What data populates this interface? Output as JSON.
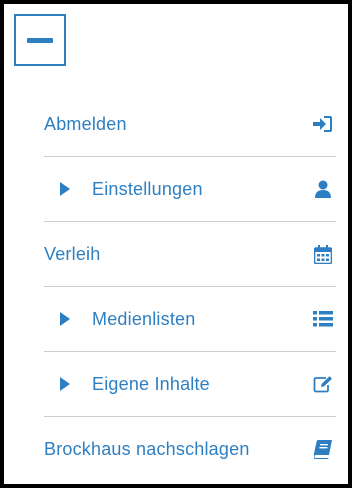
{
  "menu": {
    "toggle_icon": "minus-icon",
    "accent_color": "#2e7fc2",
    "items": [
      {
        "label": "Abmelden",
        "icon": "sign-in-icon",
        "expandable": false
      },
      {
        "label": "Einstellungen",
        "icon": "user-icon",
        "expandable": true
      },
      {
        "label": "Verleih",
        "icon": "calendar-icon",
        "expandable": false
      },
      {
        "label": "Medienlisten",
        "icon": "list-icon",
        "expandable": true
      },
      {
        "label": "Eigene Inhalte",
        "icon": "edit-icon",
        "expandable": true
      },
      {
        "label": "Brockhaus nachschlagen",
        "icon": "book-icon",
        "expandable": false
      }
    ]
  }
}
